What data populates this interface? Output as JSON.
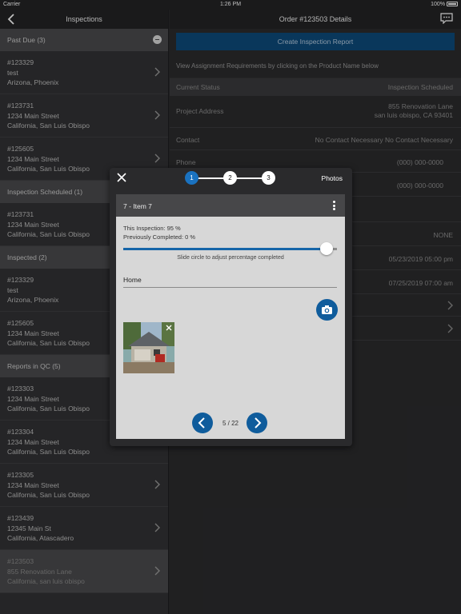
{
  "status_bar": {
    "carrier": "Carrier",
    "time": "1:26 PM",
    "battery": "100%"
  },
  "left_nav": {
    "title": "Inspections"
  },
  "sections": [
    {
      "header": "Past Due (3)",
      "items": [
        {
          "id": "#123329",
          "line1": "test",
          "line2": "Arizona, Phoenix"
        },
        {
          "id": "#123731",
          "line1": "1234 Main Street",
          "line2": "California, San Luis Obispo"
        },
        {
          "id": "#125605",
          "line1": "1234 Main Street",
          "line2": "California, San Luis Obispo"
        }
      ]
    },
    {
      "header": "Inspection Scheduled (1)",
      "items": [
        {
          "id": "#123731",
          "line1": "1234 Main Street",
          "line2": "California, San Luis Obispo"
        }
      ]
    },
    {
      "header": "Inspected (2)",
      "items": [
        {
          "id": "#123329",
          "line1": "test",
          "line2": "Arizona, Phoenix"
        },
        {
          "id": "#125605",
          "line1": "1234 Main Street",
          "line2": "California, San Luis Obispo"
        }
      ]
    },
    {
      "header": "Reports in QC (5)",
      "items": [
        {
          "id": "#123303",
          "line1": "1234 Main Street",
          "line2": "California, San Luis Obispo"
        },
        {
          "id": "#123304",
          "line1": "1234 Main Street",
          "line2": "California, San Luis Obispo"
        },
        {
          "id": "#123305",
          "line1": "1234 Main Street",
          "line2": "California, San Luis Obispo"
        },
        {
          "id": "#123439",
          "line1": "12345 Main St",
          "line2": "California, Atascadero"
        },
        {
          "id": "#123503",
          "line1": "855 Renovation Lane",
          "line2": "California, san luis obispo"
        }
      ]
    }
  ],
  "detail": {
    "title": "Order #123503 Details",
    "create_button": "Create Inspection Report",
    "hint": "View Assignment Requirements by clicking on the Product Name below",
    "status_label": "Current Status",
    "status_value": "Inspection Scheduled",
    "address_label": "Project Address",
    "address_line1": "855 Renovation Lane",
    "address_line2": "san luis obispo, CA 93401",
    "contact_label": "Contact",
    "contact_value": "No Contact Necessary  No Contact Necessary",
    "phone_label": "Phone",
    "phone_value": "(000) 000-0000",
    "phone2_value": "(000) 000-0000",
    "none_value": "NONE",
    "date1": "05/23/2019 05:00 pm",
    "date2": "07/25/2019 07:00 am"
  },
  "modal": {
    "steps": [
      "1",
      "2",
      "3"
    ],
    "active_step": 1,
    "tab_label": "Photos",
    "item_title": "7 - Item 7",
    "this_inspection": "This Inspection:  95 %",
    "previously_completed": "Previously Completed:  0 %",
    "slider_percent": 95,
    "slider_hint": "Slide circle to adjust percentage completed",
    "answer": "Home",
    "pager": "5 / 22"
  },
  "colors": {
    "accent": "#0f5c9c",
    "step_active": "#1a72c0"
  }
}
